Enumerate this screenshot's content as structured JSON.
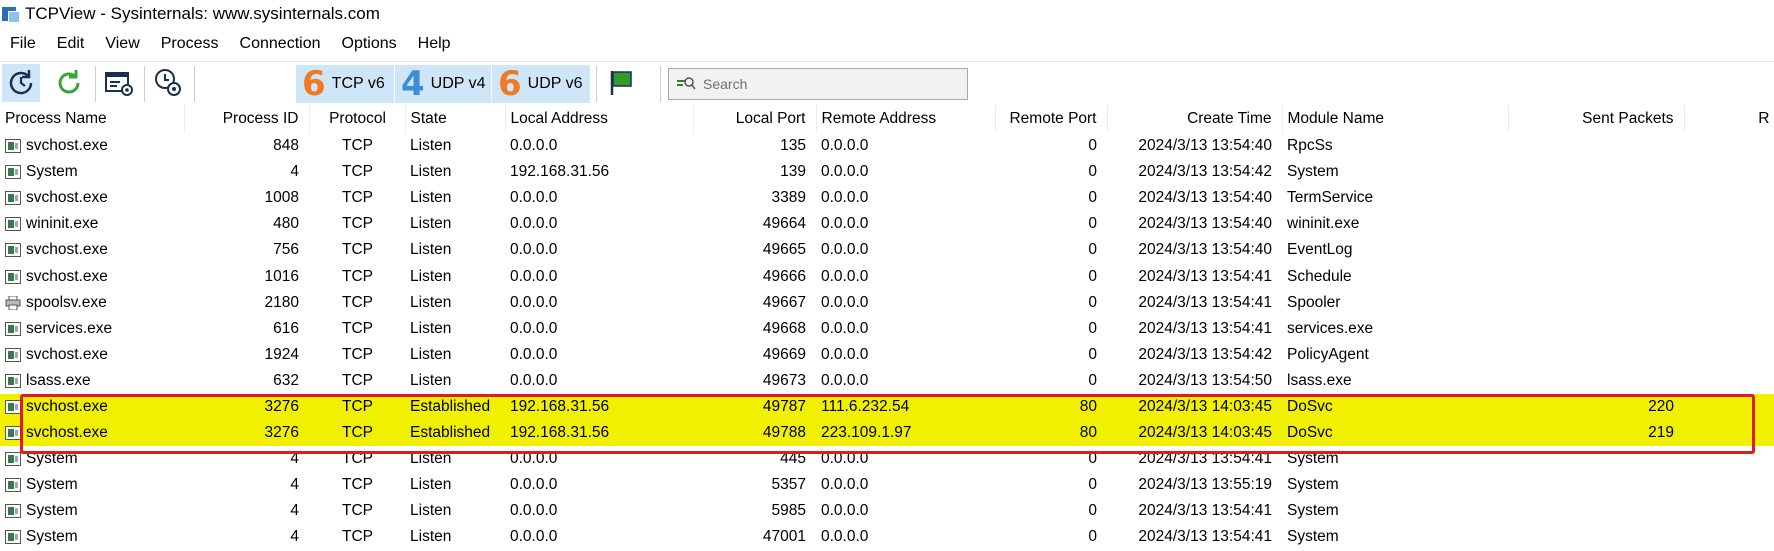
{
  "window": {
    "title": "TCPView - Sysinternals: www.sysinternals.com"
  },
  "menu": [
    "File",
    "Edit",
    "View",
    "Process",
    "Connection",
    "Options",
    "Help"
  ],
  "toolbar": {
    "buttons": [
      {
        "icon": "refresh-clock-icon"
      },
      {
        "icon": "refresh-icon"
      },
      {
        "icon": "settings-window-icon"
      },
      {
        "icon": "options-gear-icon"
      }
    ],
    "filters": [
      {
        "number": "6",
        "label": "TCP v6",
        "color": "#f07a23"
      },
      {
        "number": "4",
        "label": "UDP v4",
        "color": "#3b8ed6"
      },
      {
        "number": "6",
        "label": "UDP v6",
        "color": "#f07a23"
      }
    ],
    "flag_icon": "flag-icon",
    "search_placeholder": "Search"
  },
  "columns": [
    "Process Name",
    "Process ID",
    "Protocol",
    "State",
    "Local Address",
    "Local Port",
    "Remote Address",
    "Remote Port",
    "Create Time",
    "Module Name",
    "Sent Packets",
    "R"
  ],
  "rows": [
    {
      "icon": "win",
      "process": "svchost.exe",
      "pid": "848",
      "protocol": "TCP",
      "state": "Listen",
      "local_address": "0.0.0.0",
      "local_port": "135",
      "remote_address": "0.0.0.0",
      "remote_port": "0",
      "create_time": "2024/3/13 13:54:40",
      "module": "RpcSs",
      "sent": "",
      "highlight": false
    },
    {
      "icon": "win",
      "process": "System",
      "pid": "4",
      "protocol": "TCP",
      "state": "Listen",
      "local_address": "192.168.31.56",
      "local_port": "139",
      "remote_address": "0.0.0.0",
      "remote_port": "0",
      "create_time": "2024/3/13 13:54:42",
      "module": "System",
      "sent": "",
      "highlight": false
    },
    {
      "icon": "win",
      "process": "svchost.exe",
      "pid": "1008",
      "protocol": "TCP",
      "state": "Listen",
      "local_address": "0.0.0.0",
      "local_port": "3389",
      "remote_address": "0.0.0.0",
      "remote_port": "0",
      "create_time": "2024/3/13 13:54:40",
      "module": "TermService",
      "sent": "",
      "highlight": false
    },
    {
      "icon": "win",
      "process": "wininit.exe",
      "pid": "480",
      "protocol": "TCP",
      "state": "Listen",
      "local_address": "0.0.0.0",
      "local_port": "49664",
      "remote_address": "0.0.0.0",
      "remote_port": "0",
      "create_time": "2024/3/13 13:54:40",
      "module": "wininit.exe",
      "sent": "",
      "highlight": false
    },
    {
      "icon": "win",
      "process": "svchost.exe",
      "pid": "756",
      "protocol": "TCP",
      "state": "Listen",
      "local_address": "0.0.0.0",
      "local_port": "49665",
      "remote_address": "0.0.0.0",
      "remote_port": "0",
      "create_time": "2024/3/13 13:54:40",
      "module": "EventLog",
      "sent": "",
      "highlight": false
    },
    {
      "icon": "win",
      "process": "svchost.exe",
      "pid": "1016",
      "protocol": "TCP",
      "state": "Listen",
      "local_address": "0.0.0.0",
      "local_port": "49666",
      "remote_address": "0.0.0.0",
      "remote_port": "0",
      "create_time": "2024/3/13 13:54:41",
      "module": "Schedule",
      "sent": "",
      "highlight": false
    },
    {
      "icon": "printer",
      "process": "spoolsv.exe",
      "pid": "2180",
      "protocol": "TCP",
      "state": "Listen",
      "local_address": "0.0.0.0",
      "local_port": "49667",
      "remote_address": "0.0.0.0",
      "remote_port": "0",
      "create_time": "2024/3/13 13:54:41",
      "module": "Spooler",
      "sent": "",
      "highlight": false
    },
    {
      "icon": "win",
      "process": "services.exe",
      "pid": "616",
      "protocol": "TCP",
      "state": "Listen",
      "local_address": "0.0.0.0",
      "local_port": "49668",
      "remote_address": "0.0.0.0",
      "remote_port": "0",
      "create_time": "2024/3/13 13:54:41",
      "module": "services.exe",
      "sent": "",
      "highlight": false
    },
    {
      "icon": "win",
      "process": "svchost.exe",
      "pid": "1924",
      "protocol": "TCP",
      "state": "Listen",
      "local_address": "0.0.0.0",
      "local_port": "49669",
      "remote_address": "0.0.0.0",
      "remote_port": "0",
      "create_time": "2024/3/13 13:54:42",
      "module": "PolicyAgent",
      "sent": "",
      "highlight": false
    },
    {
      "icon": "win",
      "process": "lsass.exe",
      "pid": "632",
      "protocol": "TCP",
      "state": "Listen",
      "local_address": "0.0.0.0",
      "local_port": "49673",
      "remote_address": "0.0.0.0",
      "remote_port": "0",
      "create_time": "2024/3/13 13:54:50",
      "module": "lsass.exe",
      "sent": "",
      "highlight": false
    },
    {
      "icon": "win",
      "process": "svchost.exe",
      "pid": "3276",
      "protocol": "TCP",
      "state": "Established",
      "local_address": "192.168.31.56",
      "local_port": "49787",
      "remote_address": "111.6.232.54",
      "remote_port": "80",
      "create_time": "2024/3/13 14:03:45",
      "module": "DoSvc",
      "sent": "220",
      "highlight": true
    },
    {
      "icon": "win",
      "process": "svchost.exe",
      "pid": "3276",
      "protocol": "TCP",
      "state": "Established",
      "local_address": "192.168.31.56",
      "local_port": "49788",
      "remote_address": "223.109.1.97",
      "remote_port": "80",
      "create_time": "2024/3/13 14:03:45",
      "module": "DoSvc",
      "sent": "219",
      "highlight": true
    },
    {
      "icon": "win",
      "process": "System",
      "pid": "4",
      "protocol": "TCP",
      "state": "Listen",
      "local_address": "0.0.0.0",
      "local_port": "445",
      "remote_address": "0.0.0.0",
      "remote_port": "0",
      "create_time": "2024/3/13 13:54:41",
      "module": "System",
      "sent": "",
      "highlight": false
    },
    {
      "icon": "win",
      "process": "System",
      "pid": "4",
      "protocol": "TCP",
      "state": "Listen",
      "local_address": "0.0.0.0",
      "local_port": "5357",
      "remote_address": "0.0.0.0",
      "remote_port": "0",
      "create_time": "2024/3/13 13:55:19",
      "module": "System",
      "sent": "",
      "highlight": false
    },
    {
      "icon": "win",
      "process": "System",
      "pid": "4",
      "protocol": "TCP",
      "state": "Listen",
      "local_address": "0.0.0.0",
      "local_port": "5985",
      "remote_address": "0.0.0.0",
      "remote_port": "0",
      "create_time": "2024/3/13 13:54:41",
      "module": "System",
      "sent": "",
      "highlight": false
    },
    {
      "icon": "win",
      "process": "System",
      "pid": "4",
      "protocol": "TCP",
      "state": "Listen",
      "local_address": "0.0.0.0",
      "local_port": "47001",
      "remote_address": "0.0.0.0",
      "remote_port": "0",
      "create_time": "2024/3/13 13:54:41",
      "module": "System",
      "sent": "",
      "highlight": false
    }
  ],
  "colors": {
    "highlight": "#f0f000",
    "annotation_box": "#e01b1b"
  }
}
